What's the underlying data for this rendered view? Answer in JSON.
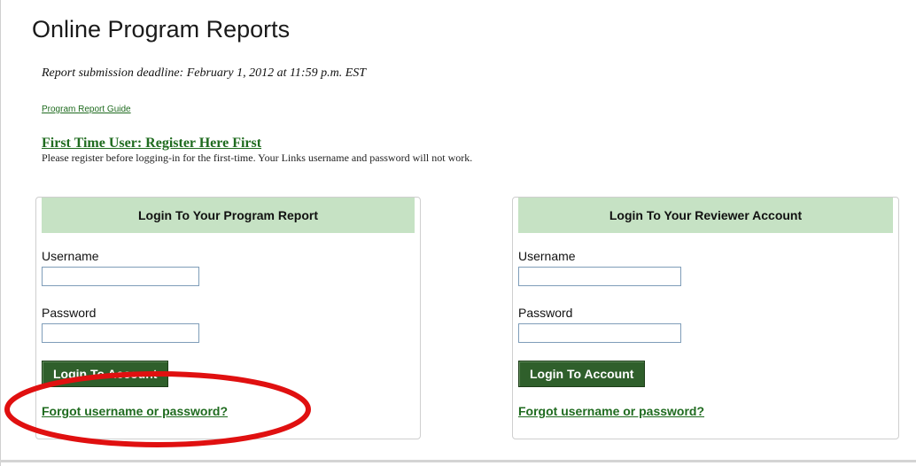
{
  "page": {
    "title": "Online Program Reports",
    "deadline": "Report submission deadline: February 1, 2012 at 11:59 p.m. EST",
    "guide_link": "Program Report Guide",
    "register_link": "First Time User: Register Here First",
    "register_note": "Please register before logging-in for the first-time. Your Links username and password will not work."
  },
  "program_login": {
    "header": "Login To Your Program Report",
    "username_label": "Username",
    "username_value": "",
    "password_label": "Password",
    "password_value": "",
    "button": "Login To Account",
    "forgot_link": "Forgot username or password?"
  },
  "reviewer_login": {
    "header": "Login To Your Reviewer Account",
    "username_label": "Username",
    "username_value": "",
    "password_label": "Password",
    "password_value": "",
    "button": "Login To Account",
    "forgot_link": "Forgot username or password?"
  },
  "colors": {
    "panel_header_bg": "#c6e2c4",
    "button_bg": "#2f5f2b",
    "link": "#1f6b1f",
    "annotation": "#e01010"
  }
}
